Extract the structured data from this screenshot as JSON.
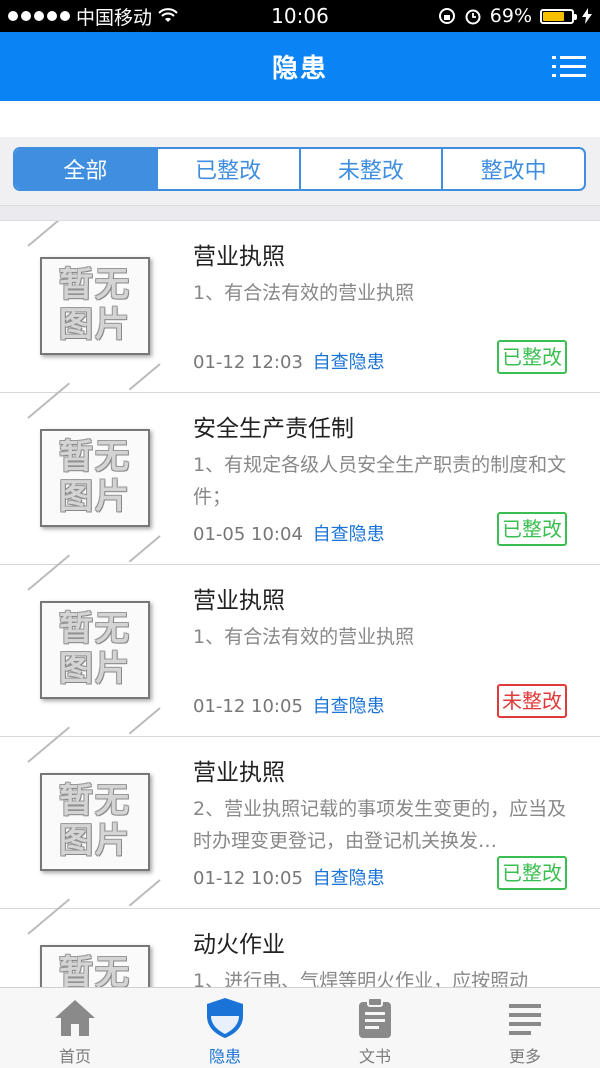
{
  "status_bar": {
    "carrier": "中国移动",
    "time": "10:06",
    "battery": "69%"
  },
  "navbar": {
    "title": "隐患"
  },
  "segments": [
    "全部",
    "已整改",
    "未整改",
    "整改中"
  ],
  "active_segment": 0,
  "placeholder": {
    "line1": "暂无",
    "line2": "图片"
  },
  "items": [
    {
      "title": "营业执照",
      "desc": "1、有合法有效的营业执照",
      "time": "01-12 12:03",
      "source": "自查隐患",
      "status": "已整改",
      "status_color": "#3bbf52"
    },
    {
      "title": "安全生产责任制",
      "desc": "1、有规定各级人员安全生产职责的制度和文件；",
      "time": "01-05 10:04",
      "source": "自查隐患",
      "status": "已整改",
      "status_color": "#3bbf52"
    },
    {
      "title": "营业执照",
      "desc": "1、有合法有效的营业执照",
      "time": "01-12 10:05",
      "source": "自查隐患",
      "status": "未整改",
      "status_color": "#e03a3a"
    },
    {
      "title": "营业执照",
      "desc": "2、营业执照记载的事项发生变更的，应当及时办理变更登记，由登记机关换发…",
      "time": "01-12 10:05",
      "source": "自查隐患",
      "status": "已整改",
      "status_color": "#3bbf52"
    },
    {
      "title": "动火作业",
      "desc": "1、进行电、气焊等明火作业，应按照动",
      "time": "",
      "source": "",
      "status": "",
      "status_color": ""
    }
  ],
  "tabbar": [
    {
      "label": "首页",
      "icon": "home-icon"
    },
    {
      "label": "隐患",
      "icon": "shield-icon"
    },
    {
      "label": "文书",
      "icon": "clipboard-icon"
    },
    {
      "label": "更多",
      "icon": "list-icon"
    }
  ],
  "active_tab": 1,
  "colors": {
    "accent": "#0a84f5",
    "segment": "#3f8ee0",
    "link": "#1a73d6"
  }
}
